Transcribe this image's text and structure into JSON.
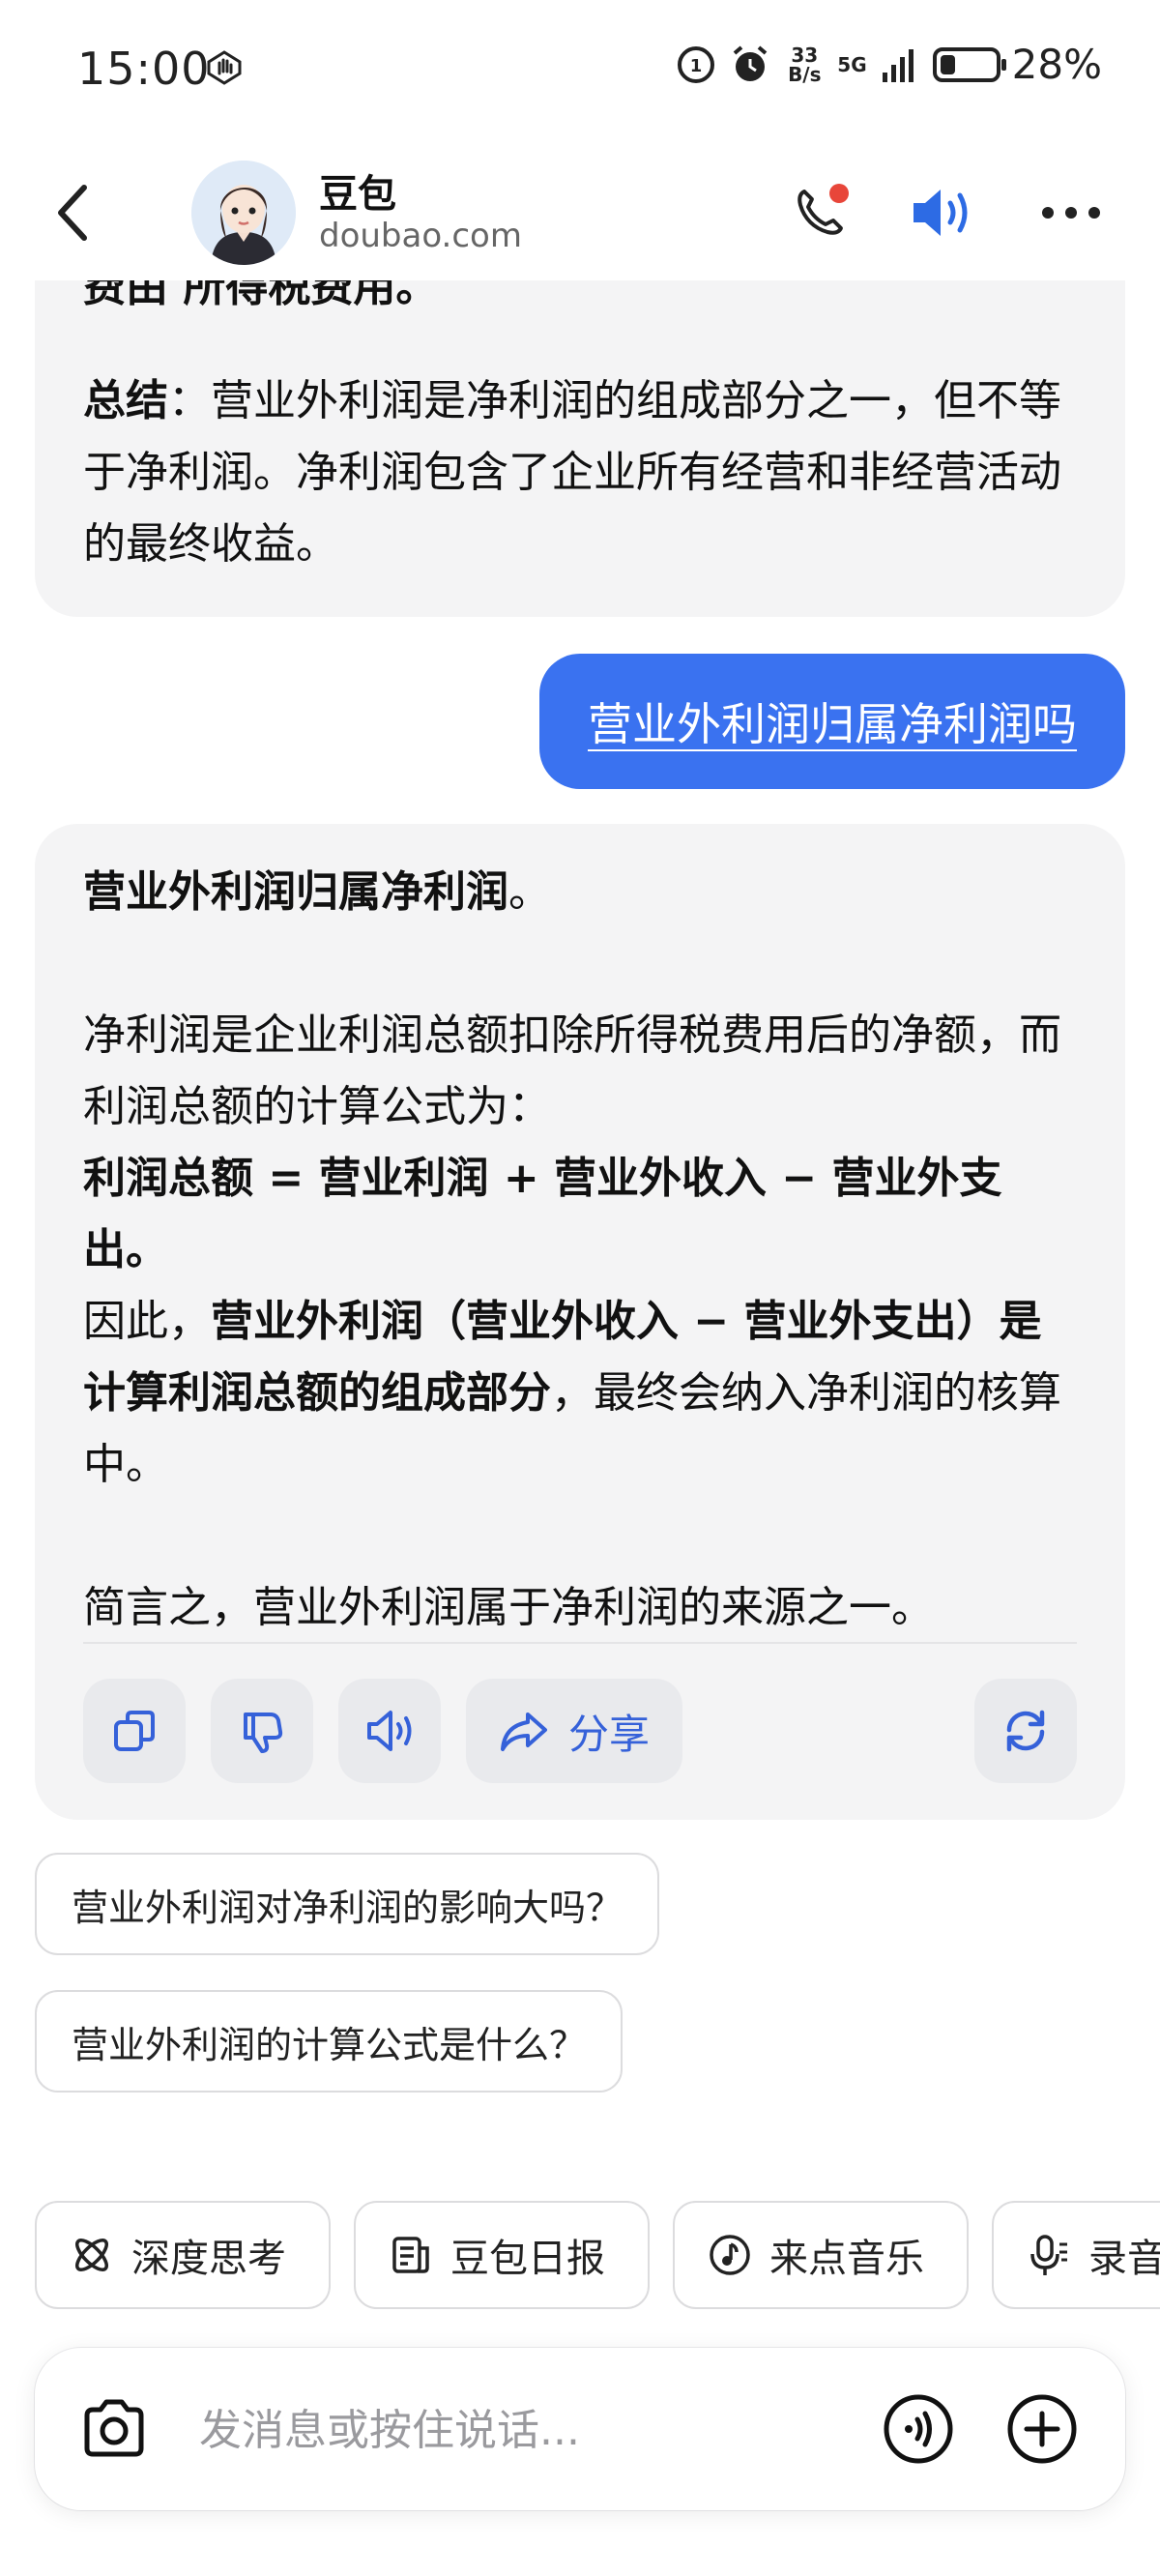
{
  "status_bar": {
    "time": "15:00",
    "net_speed_value": "33",
    "net_speed_unit": "B/s",
    "network": "5G",
    "battery_percent": "28%",
    "battery_level": 0.28
  },
  "header": {
    "name": "豆包",
    "domain": "doubao.com"
  },
  "messages": {
    "prev_partial": "费由 所得税费用。",
    "prev_summary_label": "总结",
    "prev_summary_text": "：营业外利润是净利润的组成部分之一，但不等于净利润。净利润包含了企业所有经营和非经营活动的最终收益。",
    "user_question": "营业外利润归属净利润吗",
    "answer": {
      "heading_bold": "营业外利润归属净利润",
      "heading_end": "。",
      "para1": "净利润是企业利润总额扣除所得税费用后的净额，而利润总额的计算公式为：",
      "formula": "利润总额 = 营业利润 + 营业外收入 − 营业外支出。",
      "para3_start": "因此，",
      "para3_bold": "营业外利润（营业外收入 − 营业外支出）是计算利润总额的组成部分",
      "para3_end": "，最终会纳入净利润的核算中。",
      "para4": "简言之，营业外利润属于净利润的来源之一。"
    },
    "actions": {
      "share_label": "分享"
    }
  },
  "suggestions": [
    "营业外利润对净利润的影响大吗？",
    "营业外利润的计算公式是什么？"
  ],
  "chips": [
    {
      "label": "深度思考",
      "icon": "atom-icon"
    },
    {
      "label": "豆包日报",
      "icon": "news-icon"
    },
    {
      "label": "来点音乐",
      "icon": "music-icon"
    },
    {
      "label": "录音",
      "icon": "mic-icon"
    }
  ],
  "input": {
    "placeholder": "发消息或按住说话..."
  },
  "colors": {
    "accent": "#3a72f0",
    "bubble": "#f4f4f5",
    "action_icon": "#3561d9"
  }
}
